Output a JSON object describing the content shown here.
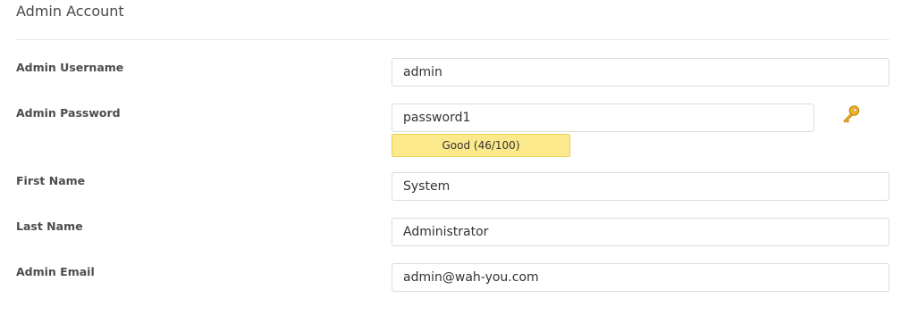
{
  "section": {
    "title": "Admin Account"
  },
  "fields": {
    "username": {
      "label": "Admin Username",
      "value": "admin"
    },
    "password": {
      "label": "Admin Password",
      "value": "password1",
      "strength_text": "Good (46/100)",
      "strength_score": 46,
      "strength_max": 100
    },
    "first_name": {
      "label": "First Name",
      "value": "System"
    },
    "last_name": {
      "label": "Last Name",
      "value": "Administrator"
    },
    "email": {
      "label": "Admin Email",
      "value": "admin@wah-you.com"
    }
  },
  "icons": {
    "password_generator": "key-icon"
  },
  "colors": {
    "strength_bg": "#fbe98b",
    "strength_border": "#e8d25a",
    "key_gold": "#e4a11b"
  }
}
